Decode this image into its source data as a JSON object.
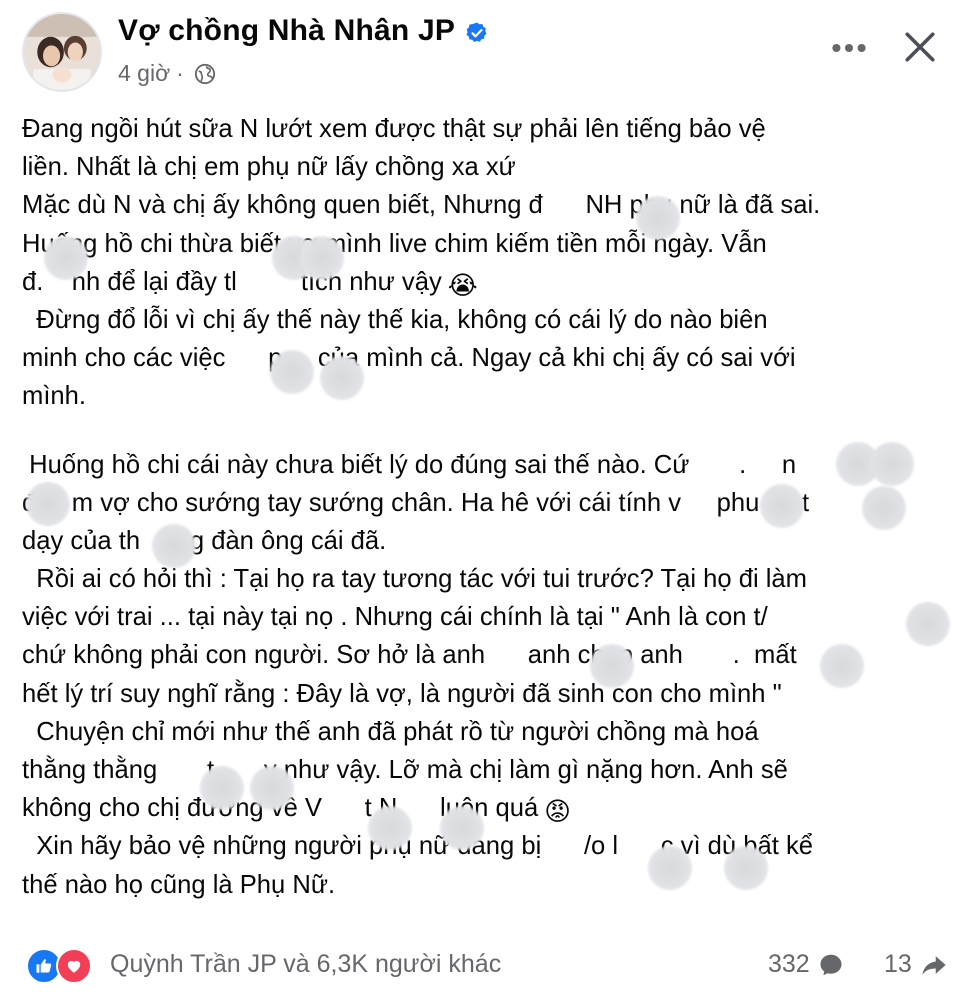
{
  "post": {
    "author": "Vợ chồng Nhà Nhân JP",
    "time": "4 giờ",
    "privacy_icon": "globe-icon",
    "lines": [
      "Đang ngồi hút sữa N lướt xem được thật sự phải lên tiếng bảo vệ",
      "liền. Nhất là chị em phụ nữ lấy chồng xa xứ",
      "Mặc dù N và chị ấy không quen biết, Nhưng đ      NH phụ nữ là đã sai.",
      "Huống hồ chi thừa biết vợ mình live chim kiếm tiền mỗi ngày. Vẫn",
      "đ.    nh để lại đầy tl         tích như vậy",
      "  Đừng đổ lỗi vì chị ấy thế này thế kia, không có cái lý do nào biên",
      "minh cho các việc      p     của mình cả. Ngay cả khi chị ấy có sai với",
      "mình.",
      " Huống hồ chi cái này chưa biết lý do đúng sai thế nào. Cứ       .     n",
      "đ     m vợ cho sướng tay sướng chân. Ha hê với cái tính v     phu      t",
      "dạy của th       g đàn ông cái đã.",
      "  Rồi ai có hỏi thì : Tại họ ra tay tương tác với tui trước? Tại họ đi làm",
      "việc với trai ... tại này tại nọ . Nhưng cái chính là tại \" Anh là con t/     ",
      "chứ không phải con người. Sơ hở là anh      anh chụp anh       .  mất",
      "hết lý trí suy nghĩ rằng : Đây là vợ, là người đã sinh con cho mình \"",
      "  Chuyện chỉ mới như thế anh đã phát rồ từ người chồng mà hoá",
      "thằng thằng       t       y như vậy. Lỡ mà chị làm gì nặng hơn. Anh sẽ",
      "không cho chị đường về V      t N      luôn quá",
      "  Xin hãy bảo vệ những người phụ nữ đang bị      /o l      c vì dù bất kể",
      "thế nào họ cũng là Phụ Nữ."
    ],
    "emoji_crying": "😭",
    "emoji_angry": "😡"
  },
  "footer": {
    "reactions_text": "Quỳnh Trần JP và 6,3K người khác",
    "comments_count": "332",
    "shares_count": "13"
  },
  "colors": {
    "text": "#080809",
    "secondary": "#65676b",
    "verified": "#1877f2",
    "like": "#1877f2",
    "love": "#f33e58"
  }
}
